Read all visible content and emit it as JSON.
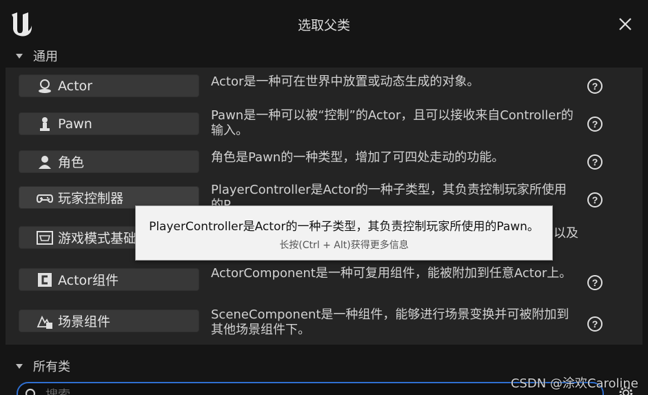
{
  "window": {
    "title": "选取父类"
  },
  "sections": {
    "common": {
      "label": "通用"
    },
    "all": {
      "label": "所有类"
    }
  },
  "classes": [
    {
      "label": "Actor",
      "icon": "actor-icon",
      "desc": "Actor是一种可在世界中放置或动态生成的对象。"
    },
    {
      "label": "Pawn",
      "icon": "pawn-icon",
      "desc": "Pawn是一种可以被“控制”的Actor，且可以接收来自Controller的输入。"
    },
    {
      "label": "角色",
      "icon": "character-icon",
      "desc": "角色是Pawn的一种类型，增加了可四处走动的功能。"
    },
    {
      "label": "玩家控制器",
      "icon": "gamepad-icon",
      "desc": "PlayerController是Actor的一种子类型，其负责控制玩家所使用的P"
    },
    {
      "label": "游戏模式基础",
      "icon": "game-mode-icon",
      "desc": "以及"
    },
    {
      "label": "Actor组件",
      "icon": "actor-component-icon",
      "desc": "ActorComponent是一种可复用组件，能被附加到任意Actor上。"
    },
    {
      "label": "场景组件",
      "icon": "scene-component-icon",
      "desc": "SceneComponent是一种组件，能够进行场景变换并可被附加到其他场景组件下。"
    }
  ],
  "tooltip": {
    "main": "PlayerController是Actor的一种子类型，其负责控制玩家所使用的Pawn。",
    "hint": "长按(Ctrl + Alt)获得更多信息"
  },
  "search": {
    "placeholder": "搜索"
  },
  "watermark": "CSDN @涂欢Caroline"
}
